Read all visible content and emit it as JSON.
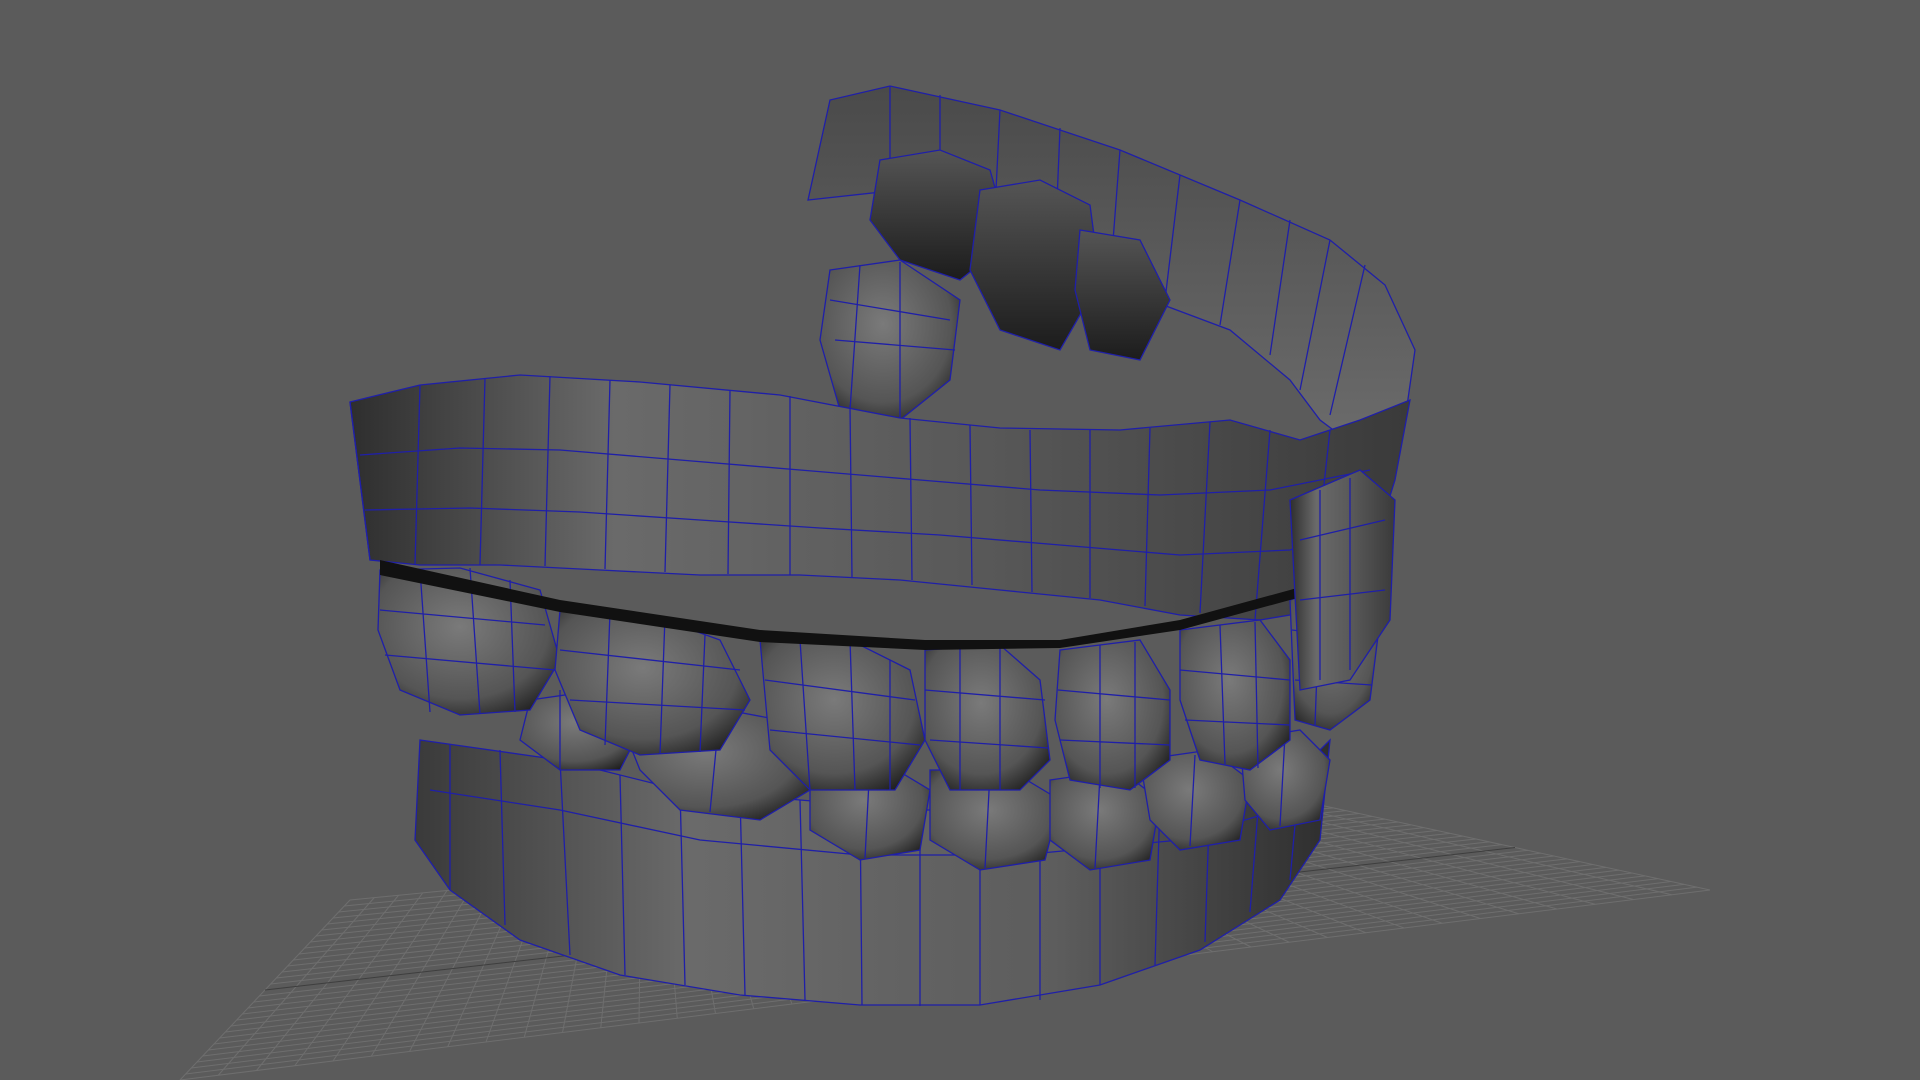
{
  "viewport": {
    "background": "#5b5b5b",
    "grid_color": "#6e6e6e",
    "grid_axis_color": "#3e3e3e",
    "wireframe_color": "#1f1fa8",
    "shading": "smooth-shaded-with-wireframe"
  },
  "scene": {
    "object": "dentures-mesh"
  }
}
